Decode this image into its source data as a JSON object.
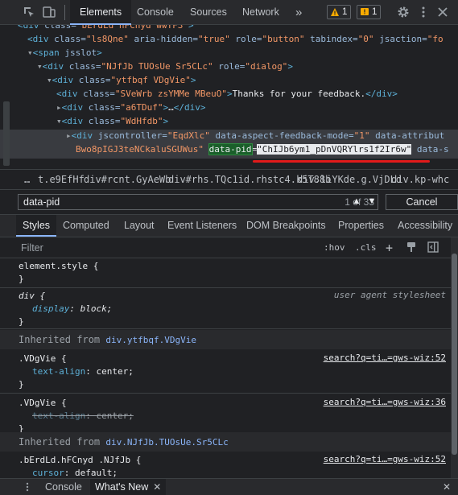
{
  "toolbar": {
    "tabs": [
      "Elements",
      "Console",
      "Sources",
      "Network"
    ],
    "more": "»",
    "warnings": "1",
    "issues": "1"
  },
  "tree": {
    "lines": [
      {
        "indent": 0,
        "html": "<span class='tag'>&lt;div</span> <span class='attr'>class=</span><span class='val'>\"bErdLd hFCnyd wwYF3\"</span><span class='tag'>&gt;</span>"
      },
      {
        "indent": 1,
        "html": "<span class='tag'>&lt;div</span> <span class='attr'>class=</span><span class='val'>\"ls8Qne\"</span> <span class='attr'>aria-hidden=</span><span class='val'>\"true\"</span> <span class='attr'>role=</span><span class='val'>\"button\"</span> <span class='attr'>tabindex=</span><span class='val'>\"0\"</span> <span class='attr'>jsaction=</span><span class='val'>\"fo</span>"
      },
      {
        "indent": 1,
        "html": "<span class='tri'>▾</span><span class='tag'>&lt;span</span> <span class='attr'>jsslot</span><span class='tag'>&gt;</span>"
      },
      {
        "indent": 2,
        "html": "<span class='tri'>▾</span><span class='tag'>&lt;div</span> <span class='attr'>class=</span><span class='val'>\"NJfJb TUOsUe Sr5CLc\"</span> <span class='attr'>role=</span><span class='val'>\"dialog\"</span><span class='tag'>&gt;</span>"
      },
      {
        "indent": 3,
        "html": "<span class='tri'>▾</span><span class='tag'>&lt;div</span> <span class='attr'>class=</span><span class='val'>\"ytfbqf VDgVie\"</span><span class='tag'>&gt;</span>"
      },
      {
        "indent": 4,
        "html": "<span class='tag'>&lt;div</span> <span class='attr'>class=</span><span class='val'>\"SVeWrb zsYMMe MBeuO\"</span><span class='tag'>&gt;</span><span class='txt'>Thanks for your feedback.</span><span class='tag'>&lt;/div&gt;</span>"
      },
      {
        "indent": 4,
        "html": "<span class='tri'>▸</span><span class='tag'>&lt;div</span> <span class='attr'>class=</span><span class='val'>\"a6TDuf\"</span><span class='tag'>&gt;</span><span class='txt'>…</span><span class='tag'>&lt;/div&gt;</span>"
      },
      {
        "indent": 4,
        "html": "<span class='tri'>▾</span><span class='tag'>&lt;div</span> <span class='attr'>class=</span><span class='val'>\"WdHfdb\"</span><span class='tag'>&gt;</span>"
      },
      {
        "indent": 5,
        "html": "<span class='tri'>▸</span><span class='tag'>&lt;div</span> <span class='attr'>jscontroller=</span><span class='val'>\"EqdXlc\"</span> <span class='attr'>data-aspect-feedback-mode=</span><span class='val'>\"1\"</span> <span class='attr'>data-attribut</span>"
      },
      {
        "indent": 6,
        "html": "<span class='val'>Bwo8pIGJ3teNCkaluSGUWus\"</span> <span class='hl'>data-pid</span><span class='txt'>=</span><span class='hlv'>\"ChIJb6ym1_pDnVQRYlrs1f2Ir6w\"</span> <span class='attr'>data-s</span>"
      }
    ]
  },
  "breadcrumbs": [
    "…",
    "t.e9EfHf",
    "div#rcnt.GyAeWb",
    "div#rhs.TQc1id.rhstc4.k5T88b",
    "div.liYKde.g.VjDLd",
    "div.kp-whc"
  ],
  "search": {
    "query": "data-pid",
    "count": "1 of 33",
    "cancel": "Cancel"
  },
  "style_tabs": [
    "Styles",
    "Computed",
    "Layout",
    "Event Listeners",
    "DOM Breakpoints",
    "Properties",
    "Accessibility"
  ],
  "filter": {
    "placeholder": "Filter",
    "hov": ":hov",
    "cls": ".cls",
    "plus": "+"
  },
  "styles": {
    "element_style_open": "element.style {",
    "close": "}",
    "div_sel": "div {",
    "div_prop": "display",
    "div_val": "block;",
    "ua_label": "user agent stylesheet",
    "inherited_label": "Inherited from",
    "inherited1": "div.ytfbqf.VDgVie",
    "rule1_sel": ".VDgVie {",
    "rule1_src": "search?q=ti…=gws-wiz:52",
    "rule1_prop": "text-align",
    "rule1_val": "center;",
    "rule2_sel": ".VDgVie {",
    "rule2_src": "search?q=ti…=gws-wiz:36",
    "rule2_prop": "text-align",
    "rule2_val": "center;",
    "inherited2": "div.NJfJb.TUOsUe.Sr5CLc",
    "rule3_sel": ".bErdLd.hFCnyd .NJfJb {",
    "rule3_src": "search?q=ti…=gws-wiz:52",
    "rule3_prop": "cursor",
    "rule3_val": "default;"
  },
  "drawer": {
    "console": "Console",
    "whatsnew": "What's New",
    "close": "✕"
  }
}
